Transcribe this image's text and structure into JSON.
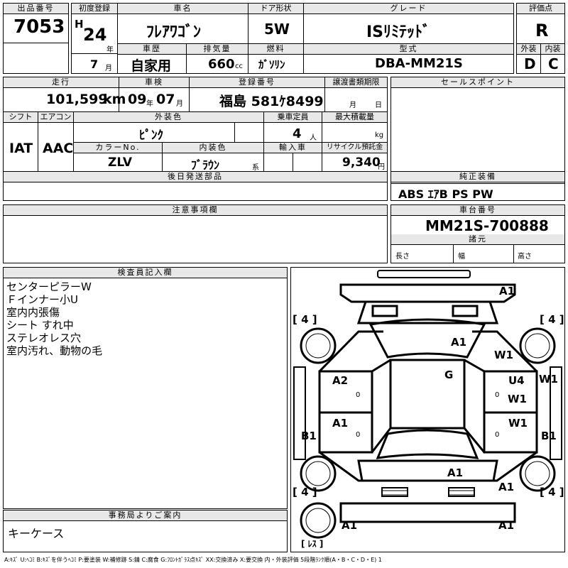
{
  "labels": {
    "lot_no": "出品番号",
    "first_reg": "初度登録",
    "car_name": "車名",
    "door": "ドア形状",
    "grade": "グレード",
    "score": "評価点",
    "history": "車歴",
    "displacement": "排気量",
    "fuel": "燃料",
    "model": "型式",
    "exterior": "外装",
    "interior": "内装",
    "mileage": "走行",
    "inspection": "車検",
    "reg_no": "登録番号",
    "transfer": "譲渡書類期限",
    "sales_point": "セールスポイント",
    "shift": "シフト",
    "aircon": "エアコン",
    "ext_color": "外装色",
    "capacity": "乗車定員",
    "max_load": "最大積載量",
    "color_no": "カラーNo.",
    "int_color": "内装色",
    "import": "輸入車",
    "recycle": "リサイクル預託金",
    "later_parts": "後日発送部品",
    "genuine": "純正装備",
    "notes": "注意事項欄",
    "chassis": "車台番号",
    "specs": "諸元",
    "length": "長さ",
    "width": "幅",
    "height": "高さ",
    "inspector": "検査員記入欄",
    "office": "事務局よりご案内"
  },
  "lot": {
    "number": "7053"
  },
  "first_reg": {
    "era": "H",
    "year": "24",
    "year_unit": "年",
    "month": "7",
    "month_unit": "月"
  },
  "car": {
    "name": "ﾌﾚｱﾜｺﾞﾝ",
    "door": "5W",
    "grade": "ISﾘﾐﾃｯﾄﾞ"
  },
  "history_value": "自家用",
  "displacement": {
    "value": "660",
    "unit": "cc"
  },
  "fuel_value": "ｶﾞｿﾘﾝ",
  "model_code": "DBA-MM21S",
  "score": {
    "overall": "R",
    "exterior": "D",
    "interior": "C"
  },
  "mileage": {
    "value": "101,599",
    "unit": "km"
  },
  "inspection": {
    "year": "09",
    "year_unit": "年",
    "month": "07",
    "month_unit": "月"
  },
  "registration": {
    "value": "福島 581ｹ8499"
  },
  "transfer": {
    "month_unit": "月",
    "day_unit": "日"
  },
  "shift_value": "IAT",
  "aircon_value": "AAC",
  "ext_color_value": "ﾋﾟﾝｸ",
  "capacity": {
    "value": "4",
    "unit": "人"
  },
  "max_load": {
    "unit": "kg"
  },
  "color_no_value": "ZLV",
  "int_color": {
    "value": "ﾌﾞﾗｳﾝ",
    "suffix": "系"
  },
  "recycle": {
    "value": "9,340",
    "unit": "円"
  },
  "genuine_value": "ABS ｴｱB PS PW",
  "chassis_value": "MM21S-700888",
  "inspector_notes": [
    "センターピラーW",
    "Ｆインナー小U",
    "室内内張傷",
    "シート すれ中",
    "ステレオレス穴",
    "室内汚れ、動物の毛"
  ],
  "office_note": "キーケース",
  "diagram": {
    "marks": [
      "A1",
      "A1",
      "W1",
      "G",
      "A2",
      "U4",
      "W1",
      "W1",
      "A1",
      "W1",
      "B1",
      "B1",
      "A1",
      "A1",
      "A1",
      "A1"
    ],
    "tire": "4",
    "spare": "ﾚｽ",
    "zeros": "0"
  },
  "legend": "A:ｷｽﾞ U:ﾍｺﾐ B:ｷｽﾞを伴うﾍｺﾐ P:要塗装 W:補修跡 S:錆 C:腐食 G:ﾌﾛﾝﾄｶﾞﾗｽ点ｷｽﾞ XX:交換済み X:要交換 内・外装評価 5段階ﾗﾝｸ順(A・B・C・D・E) 1"
}
